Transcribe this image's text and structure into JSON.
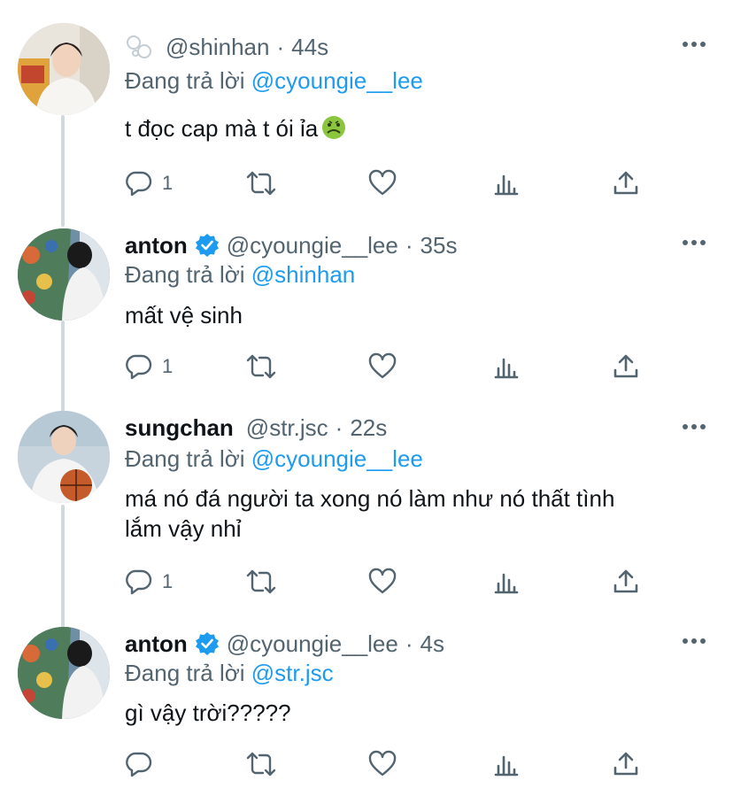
{
  "tweets": [
    {
      "name": "",
      "handle": "@shinhan",
      "separator": "·",
      "time": "44s",
      "reply_prefix": "Đang trả lời ",
      "reply_to": "@cyoungie__lee",
      "text": "t đọc cap mà t ói ỉa",
      "emoji": "nauseated-face",
      "reply_count": "1",
      "icons": [
        "reply-icon",
        "retweet-icon",
        "like-icon",
        "analytics-icon",
        "share-icon",
        "more-icon"
      ]
    },
    {
      "name": "anton",
      "verified": true,
      "handle": "@cyoungie__lee",
      "separator": "·",
      "time": "35s",
      "reply_prefix": "Đang trả lời ",
      "reply_to": "@shinhan",
      "text": "mất vệ sinh",
      "reply_count": "1"
    },
    {
      "name": "sungchan",
      "handle": "@str.jsc",
      "separator": "·",
      "time": "22s",
      "reply_prefix": "Đang trả lời ",
      "reply_to": "@cyoungie__lee",
      "text_line1": "má nó đá người ta xong nó làm như nó thất tình",
      "text_line2": "lắm vậy nhỉ",
      "reply_count": "1"
    },
    {
      "name": "anton",
      "verified": true,
      "handle": "@cyoungie__lee",
      "separator": "·",
      "time": "4s",
      "reply_prefix": "Đang trả lời ",
      "reply_to": "@str.jsc",
      "text": "gì vậy trời?????",
      "reply_count": ""
    }
  ],
  "colors": {
    "link": "#1d9bf0",
    "secondary": "#536471",
    "thread_line": "#cfd9de",
    "verified": "#1d9bf0"
  }
}
